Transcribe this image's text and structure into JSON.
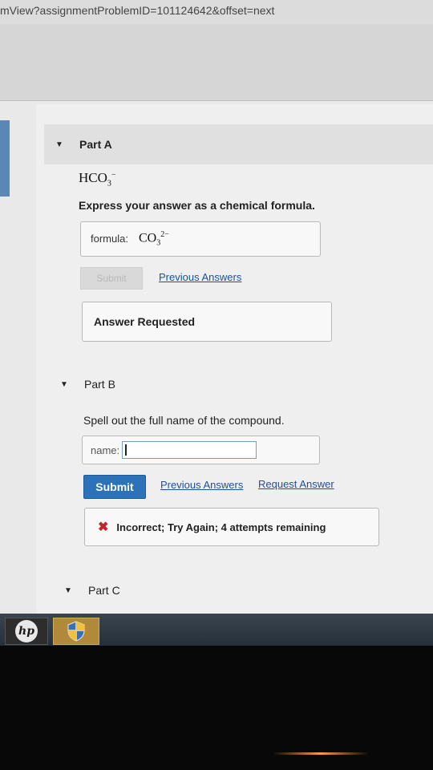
{
  "browser": {
    "url_fragment": "mView?assignmentProblemID=101124642&offset=next"
  },
  "part_a": {
    "header": "Part A",
    "formula_base": "HCO",
    "formula_sub": "3",
    "formula_sup": "−",
    "instruction": "Express your answer as a chemical formula.",
    "input_label": "formula:",
    "answer_base": "CO",
    "answer_sub": "3",
    "answer_sup": "2−",
    "submit_label": "Submit",
    "previous_answers": "Previous Answers",
    "status": "Answer Requested"
  },
  "part_b": {
    "header": "Part B",
    "instruction": "Spell out the full name of the compound.",
    "input_label": "name:",
    "input_value": "",
    "submit_label": "Submit",
    "previous_answers": "Previous Answers",
    "request_answer": "Request Answer",
    "feedback": "Incorrect; Try Again; 4 attempts remaining"
  },
  "part_c": {
    "header": "Part C"
  },
  "taskbar": {
    "hp_logo": "hp",
    "shield_icon": "shield-icon"
  },
  "colors": {
    "submit_blue": "#2b72b8",
    "link_blue": "#1f4f9c",
    "error_red": "#c0262c"
  }
}
